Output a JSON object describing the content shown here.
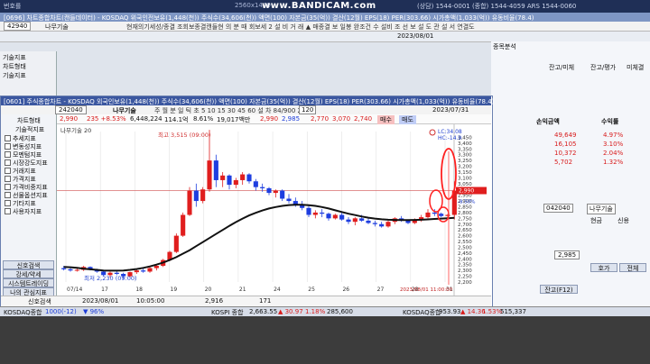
{
  "topbar": {
    "left": "번호를",
    "mid": "2560x1440",
    "bandicam": "www.BANDICAM.com",
    "right": "(상담) 1544-0001  (종합) 1544-4059  ARS 1544-0060"
  },
  "back_window": {
    "title": "[0696] 차트종합차트(캔들데이터)  - KOSDAQ 위국인전보유(1,448(천)) 주식수(34,606(천)) 액면(100) 자본금(35(억)) 결산(12월) EPS(18) PER(303.66) 시가총액(1,033(억)) 유동비율(78.4)",
    "code": "42940",
    "stock": "나무기술",
    "row2": "현재의기세성/종결 조회보종결캔들현 의 분 때  회보세  2   설 비  거 래  ▲ 매종결 보  일봉 완조건  수  설비 조 선 보 설 도  관 설 서  연결도",
    "dates": "2023/08/01"
  },
  "left_panel": [
    "기술지표",
    "차트형태",
    "기술지표"
  ],
  "main_window": {
    "title": "[0601] 주식종합차트  - KOSDAQ 외국인보유(1,448(천)) 주식수(34,606(천)) 액면(100) 자본금(35(억)) 결산(12월) EPS(18) PER(303.66) 시가총액(1,033(억)) 유동비율(78.4)",
    "toolbar": {
      "code": "242040",
      "name": "나무기술",
      "period": "2023/07/31",
      "val": "120",
      "items": "주 월 분 일 틱 초 5 10 15 30 45 60  설  차  84/900  2"
    },
    "price": {
      "cur": "2,990",
      "chg": "235 +8.53%",
      "vol": "6,448,224",
      "amt": "114.1억",
      "turn": "8.61%",
      "shares": "19,017백만",
      "ask": "2,990",
      "bid": "2,985",
      "open": "2,770",
      "high": "3,070",
      "low": "2,740",
      "buy": "매수",
      "sell": "매도"
    },
    "side_menu": [
      "차트형태",
      "기술적지표",
      "추세지표",
      "변동성지표",
      "모멘텀지표",
      "시장강도지표",
      "거래지표",
      "가격지표",
      "가격비중지표",
      "선물옵션지표",
      "기타지표",
      "사용자지표"
    ],
    "bottom_buttons": [
      "신호검색",
      "강세/약세",
      "시스템트레이딩",
      "나의 관심지표"
    ],
    "bottom_info": {
      "label": "신호검색",
      "date": "2023/08/01",
      "time": "10:05:00",
      "v1": "2,916",
      "v2": "171"
    }
  },
  "chart_data": {
    "type": "candlestick",
    "title": "나무기술 20",
    "annotations": {
      "high": "최고 3,515 (09:00)",
      "low": "최저 2,230 (09:00)",
      "lc": "LC:34.08",
      "hc": "HC:-14.9"
    },
    "x_ticks": [
      "07/14",
      "17",
      "18",
      "19",
      "20",
      "21",
      "24",
      "25",
      "26",
      "27",
      "28",
      "31",
      "2023/08/01 11:00:00"
    ],
    "y_ticks": [
      "3,450",
      "3,400",
      "3,350",
      "3,300",
      "3,250",
      "3,200",
      "3,150",
      "3,100",
      "3,050",
      "3,000",
      "2,950",
      "2,900",
      "2,850",
      "2,800",
      "2,750",
      "2,700",
      "2,650",
      "2,600",
      "2,550",
      "2,500",
      "2,450",
      "2,400",
      "2,350",
      "2,300",
      "2,250",
      "2,200"
    ],
    "y_range": [
      2200,
      3500
    ],
    "last": "2,990",
    "markers": {
      "m1": "2,957",
      "m2": "-8.50%"
    },
    "candles": [
      {
        "o": 2320,
        "h": 2340,
        "l": 2300,
        "c": 2310
      },
      {
        "o": 2310,
        "h": 2330,
        "l": 2290,
        "c": 2300
      },
      {
        "o": 2300,
        "h": 2320,
        "l": 2290,
        "c": 2305
      },
      {
        "o": 2305,
        "h": 2340,
        "l": 2295,
        "c": 2330
      },
      {
        "o": 2330,
        "h": 2335,
        "l": 2300,
        "c": 2305
      },
      {
        "o": 2305,
        "h": 2315,
        "l": 2280,
        "c": 2290
      },
      {
        "o": 2290,
        "h": 2300,
        "l": 2250,
        "c": 2260
      },
      {
        "o": 2260,
        "h": 2290,
        "l": 2240,
        "c": 2280
      },
      {
        "o": 2280,
        "h": 2300,
        "l": 2260,
        "c": 2270
      },
      {
        "o": 2270,
        "h": 2280,
        "l": 2230,
        "c": 2250
      },
      {
        "o": 2250,
        "h": 2290,
        "l": 2240,
        "c": 2285
      },
      {
        "o": 2285,
        "h": 2310,
        "l": 2270,
        "c": 2300
      },
      {
        "o": 2300,
        "h": 2320,
        "l": 2280,
        "c": 2290
      },
      {
        "o": 2290,
        "h": 2330,
        "l": 2280,
        "c": 2320
      },
      {
        "o": 2320,
        "h": 2350,
        "l": 2300,
        "c": 2340
      },
      {
        "o": 2340,
        "h": 2400,
        "l": 2330,
        "c": 2390
      },
      {
        "o": 2390,
        "h": 2470,
        "l": 2380,
        "c": 2460
      },
      {
        "o": 2460,
        "h": 2620,
        "l": 2450,
        "c": 2600
      },
      {
        "o": 2600,
        "h": 2800,
        "l": 2590,
        "c": 2780
      },
      {
        "o": 2780,
        "h": 3020,
        "l": 2770,
        "c": 2990
      },
      {
        "o": 2990,
        "h": 3050,
        "l": 2850,
        "c": 2900
      },
      {
        "o": 2900,
        "h": 3020,
        "l": 2880,
        "c": 3000
      },
      {
        "o": 3000,
        "h": 3515,
        "l": 2980,
        "c": 3250
      },
      {
        "o": 3250,
        "h": 3300,
        "l": 3020,
        "c": 3080
      },
      {
        "o": 3080,
        "h": 3150,
        "l": 3020,
        "c": 3120
      },
      {
        "o": 3120,
        "h": 3130,
        "l": 3000,
        "c": 3040
      },
      {
        "o": 3040,
        "h": 3100,
        "l": 3010,
        "c": 3080
      },
      {
        "o": 3080,
        "h": 3150,
        "l": 3040,
        "c": 3130
      },
      {
        "o": 3130,
        "h": 3140,
        "l": 3050,
        "c": 3070
      },
      {
        "o": 3070,
        "h": 3090,
        "l": 2990,
        "c": 3020
      },
      {
        "o": 3020,
        "h": 3050,
        "l": 2980,
        "c": 3010
      },
      {
        "o": 3010,
        "h": 3020,
        "l": 2950,
        "c": 2970
      },
      {
        "o": 2970,
        "h": 3000,
        "l": 2930,
        "c": 2990
      },
      {
        "o": 2990,
        "h": 3000,
        "l": 2900,
        "c": 2920
      },
      {
        "o": 2920,
        "h": 2960,
        "l": 2880,
        "c": 2900
      },
      {
        "o": 2900,
        "h": 2930,
        "l": 2850,
        "c": 2870
      },
      {
        "o": 2870,
        "h": 2900,
        "l": 2820,
        "c": 2840
      },
      {
        "o": 2840,
        "h": 2860,
        "l": 2760,
        "c": 2780
      },
      {
        "o": 2780,
        "h": 2820,
        "l": 2750,
        "c": 2800
      },
      {
        "o": 2800,
        "h": 2830,
        "l": 2760,
        "c": 2790
      },
      {
        "o": 2790,
        "h": 2800,
        "l": 2730,
        "c": 2750
      },
      {
        "o": 2750,
        "h": 2790,
        "l": 2740,
        "c": 2780
      },
      {
        "o": 2780,
        "h": 2800,
        "l": 2730,
        "c": 2740
      },
      {
        "o": 2740,
        "h": 2760,
        "l": 2700,
        "c": 2720
      },
      {
        "o": 2720,
        "h": 2760,
        "l": 2690,
        "c": 2750
      },
      {
        "o": 2750,
        "h": 2780,
        "l": 2720,
        "c": 2730
      },
      {
        "o": 2730,
        "h": 2760,
        "l": 2700,
        "c": 2710
      },
      {
        "o": 2710,
        "h": 2730,
        "l": 2680,
        "c": 2700
      },
      {
        "o": 2700,
        "h": 2720,
        "l": 2670,
        "c": 2680
      },
      {
        "o": 2680,
        "h": 2730,
        "l": 2670,
        "c": 2720
      },
      {
        "o": 2720,
        "h": 2760,
        "l": 2700,
        "c": 2750
      },
      {
        "o": 2750,
        "h": 2770,
        "l": 2720,
        "c": 2730
      },
      {
        "o": 2730,
        "h": 2740,
        "l": 2700,
        "c": 2710
      },
      {
        "o": 2710,
        "h": 2750,
        "l": 2700,
        "c": 2740
      },
      {
        "o": 2740,
        "h": 2780,
        "l": 2720,
        "c": 2760
      },
      {
        "o": 2760,
        "h": 2830,
        "l": 2750,
        "c": 2800
      },
      {
        "o": 2800,
        "h": 2830,
        "l": 2770,
        "c": 2790
      },
      {
        "o": 2790,
        "h": 2800,
        "l": 2760,
        "c": 2770
      },
      {
        "o": 2770,
        "h": 2790,
        "l": 2740,
        "c": 2780
      },
      {
        "o": 2780,
        "h": 3070,
        "l": 2740,
        "c": 2990
      }
    ],
    "ma": [
      2330,
      2328,
      2322,
      2315,
      2310,
      2305,
      2300,
      2298,
      2298,
      2300,
      2305,
      2312,
      2322,
      2335,
      2350,
      2368,
      2390,
      2415,
      2445,
      2475,
      2510,
      2545,
      2580,
      2615,
      2650,
      2685,
      2718,
      2748,
      2775,
      2798,
      2818,
      2835,
      2848,
      2858,
      2865,
      2868,
      2868,
      2864,
      2858,
      2848,
      2835,
      2820,
      2805,
      2790,
      2778,
      2766,
      2756,
      2748,
      2742,
      2738,
      2736,
      2735,
      2735,
      2736,
      2738,
      2741,
      2745,
      2748,
      2751,
      2755
    ]
  },
  "right_panel": {
    "tabs": [
      "종목분석",
      "잔고/미체",
      "잔고/평가",
      "미체결"
    ],
    "hdr": [
      "손익금액",
      "수익률"
    ],
    "rows": [
      [
        "49,649",
        "4.97%"
      ],
      [
        "16,105",
        "3.10%"
      ],
      [
        "10,372",
        "2.04%"
      ],
      [
        "5,702",
        "1.32%"
      ]
    ],
    "code": "042040",
    "name": "나무기술",
    "price": "2,985",
    "b1": "호가",
    "b2": "전체",
    "f12": "잔고(F12)",
    "opts": [
      "현금",
      "신용"
    ]
  },
  "bottombar": {
    "a": "KOSDAQ종합",
    "b": "1000(-12)",
    "c": "▼ 96%",
    "d": "KOSPI 종합",
    "e": "2,663.55",
    "f": "▲ 30.97",
    "g": "1.18%",
    "h": "285,600",
    "i": "KOSDAQ종합",
    "j": "953.93",
    "k": "▲ 14.36",
    "l": "1.53%",
    "m": "515,337"
  }
}
